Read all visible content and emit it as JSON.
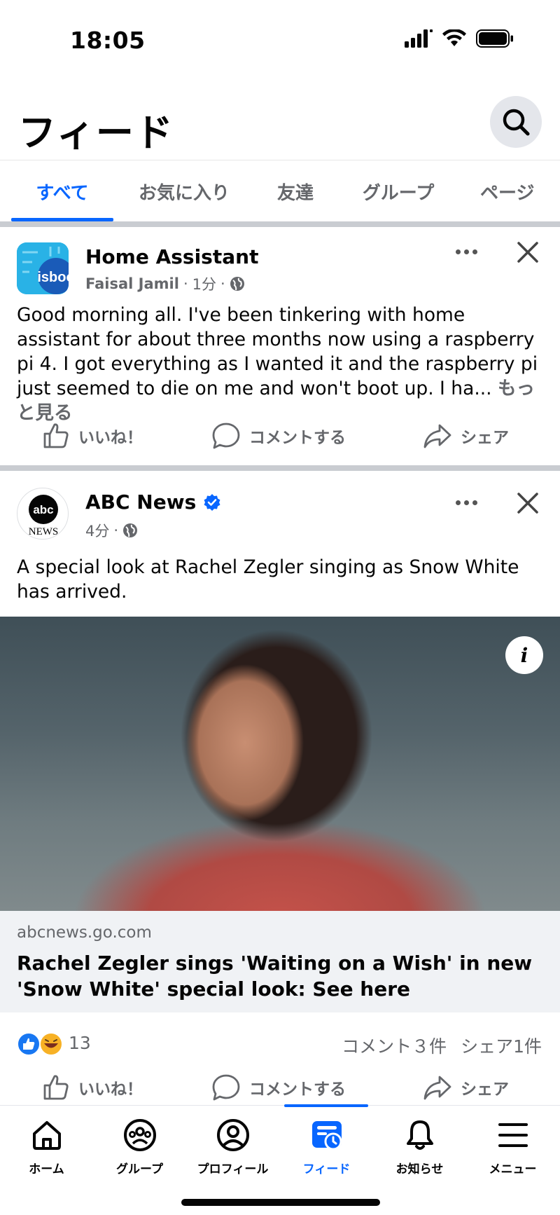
{
  "status_bar": {
    "time": "18:05",
    "icons": [
      "signal-icon",
      "wifi-icon",
      "battery-icon"
    ]
  },
  "header": {
    "title": "フィード",
    "search_icon": "search-icon"
  },
  "tabs": [
    {
      "label": "すべて",
      "active": true
    },
    {
      "label": "お気に入り",
      "active": false
    },
    {
      "label": "友達",
      "active": false
    },
    {
      "label": "グループ",
      "active": false
    },
    {
      "label": "ページ",
      "active": false
    }
  ],
  "posts": [
    {
      "name": "Home Assistant",
      "author": "Faisal Jamil",
      "time": "1分",
      "avatar_text": "isboo",
      "text": "Good morning all. I've been tinkering with home assistant for about three months now using a raspberry pi 4. I got everything as I wanted it and the raspberry pi just seemed to die on me and won't boot up. I ha...",
      "see_more": "もっと見る"
    },
    {
      "name": "ABC News",
      "verified": true,
      "time": "4分",
      "avatar_text": "abc",
      "avatar_subtext": "NEWS",
      "text": "A special look at Rachel Zegler singing as Snow White has arrived.",
      "link_domain": "abcnews.go.com",
      "link_title": "Rachel Zegler sings 'Waiting on a Wish' in new 'Snow White' special look: See here",
      "reaction_count": "13",
      "comments": "コメント３件",
      "shares": "シェア1件"
    }
  ],
  "actions": {
    "like": "いいね！",
    "comment": "コメントする",
    "share": "シェア"
  },
  "bottom_nav": [
    {
      "label": "ホーム",
      "icon": "home-icon",
      "active": false
    },
    {
      "label": "グループ",
      "icon": "groups-icon",
      "active": false
    },
    {
      "label": "プロフィール",
      "icon": "profile-icon",
      "active": false
    },
    {
      "label": "フィード",
      "icon": "feed-icon",
      "active": true
    },
    {
      "label": "お知らせ",
      "icon": "bell-icon",
      "active": false
    },
    {
      "label": "メニュー",
      "icon": "menu-icon",
      "active": false
    }
  ],
  "colors": {
    "accent": "#0866ff",
    "secondary_text": "#65676b",
    "divider": "#c9ccd1"
  }
}
